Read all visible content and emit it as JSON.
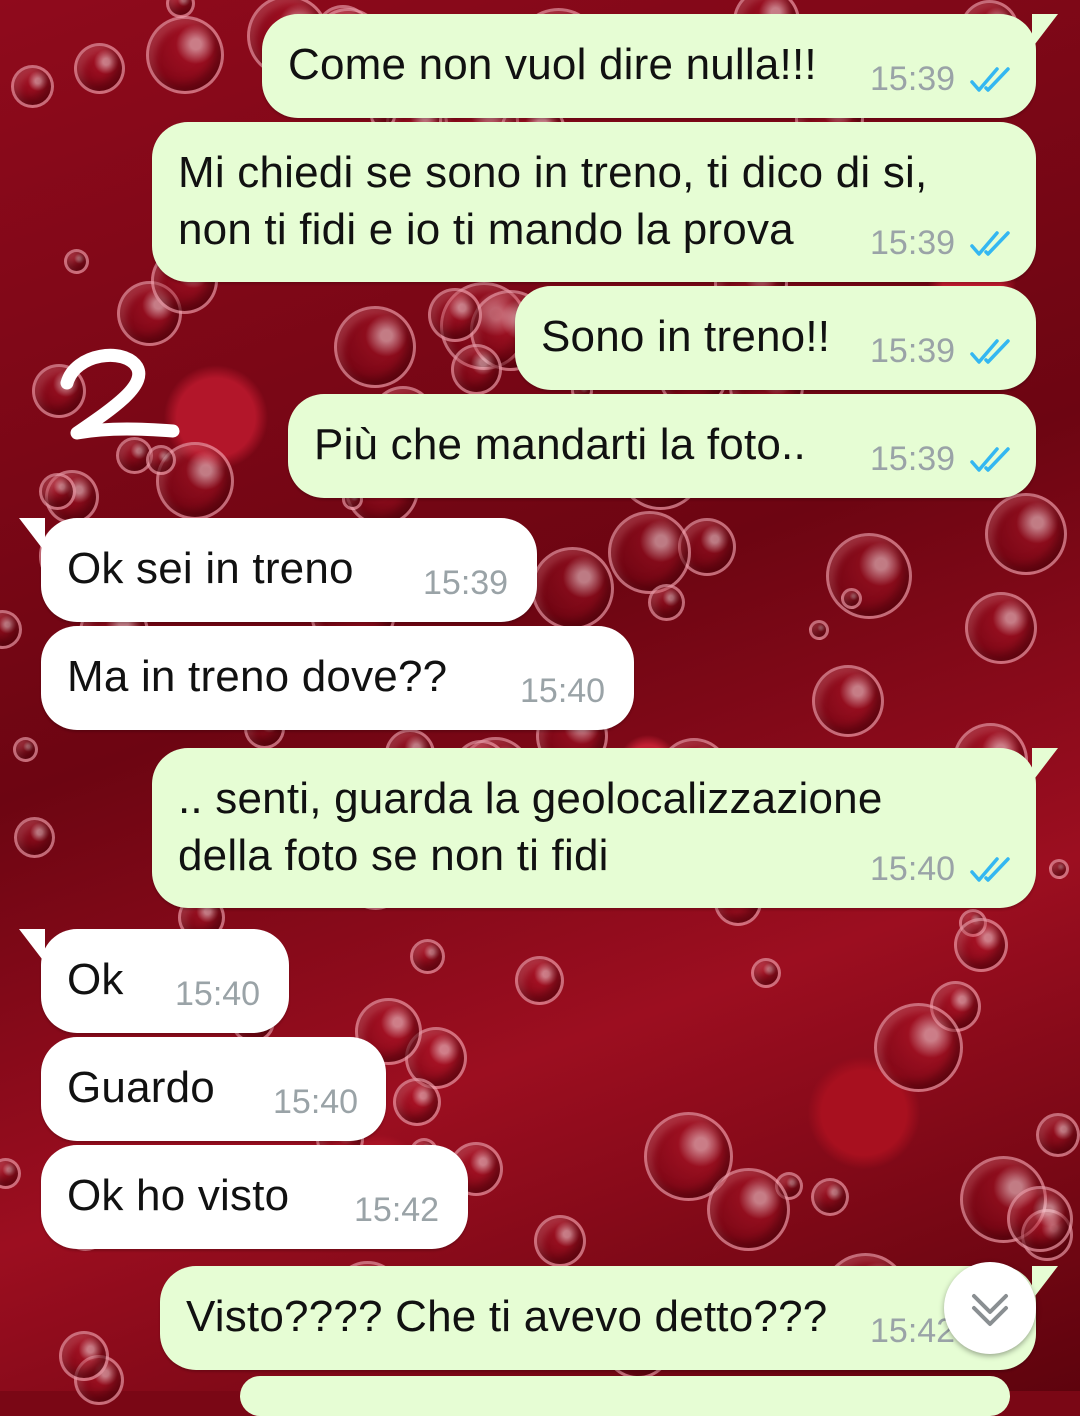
{
  "annotation": "2",
  "colors": {
    "outgoing_bubble": "#e6fdd4",
    "incoming_bubble": "#ffffff",
    "timestamp": "#9aa3a7",
    "read_ticks": "#34b7f1",
    "wallpaper": "#7a0715"
  },
  "icons": {
    "read_receipt": "double-check-icon",
    "scroll": "chevron-double-down-icon"
  },
  "messages": [
    {
      "dir": "out",
      "lines": [
        "Come non vuol dire nulla!!!"
      ],
      "time": "15:39",
      "read": true
    },
    {
      "dir": "out",
      "lines": [
        "Mi chiedi se sono in treno, ti dico di si,",
        "non ti fidi e io ti mando la prova"
      ],
      "time": "15:39",
      "read": true
    },
    {
      "dir": "out",
      "lines": [
        "Sono in treno!!"
      ],
      "time": "15:39",
      "read": true
    },
    {
      "dir": "out",
      "lines": [
        "Più che mandarti la foto.."
      ],
      "time": "15:39",
      "read": true
    },
    {
      "dir": "in",
      "lines": [
        "Ok sei in treno"
      ],
      "time": "15:39"
    },
    {
      "dir": "in",
      "lines": [
        "Ma in treno dove??"
      ],
      "time": "15:40"
    },
    {
      "dir": "out",
      "lines": [
        ".. senti, guarda la geolocalizzazione",
        "della foto se non ti fidi"
      ],
      "time": "15:40",
      "read": true
    },
    {
      "dir": "in",
      "lines": [
        "Ok"
      ],
      "time": "15:40"
    },
    {
      "dir": "in",
      "lines": [
        "Guardo"
      ],
      "time": "15:40"
    },
    {
      "dir": "in",
      "lines": [
        "Ok ho visto"
      ],
      "time": "15:42"
    },
    {
      "dir": "out",
      "lines": [
        "Visto???? Che ti avevo detto???"
      ],
      "time": "15:42",
      "read": true
    }
  ]
}
